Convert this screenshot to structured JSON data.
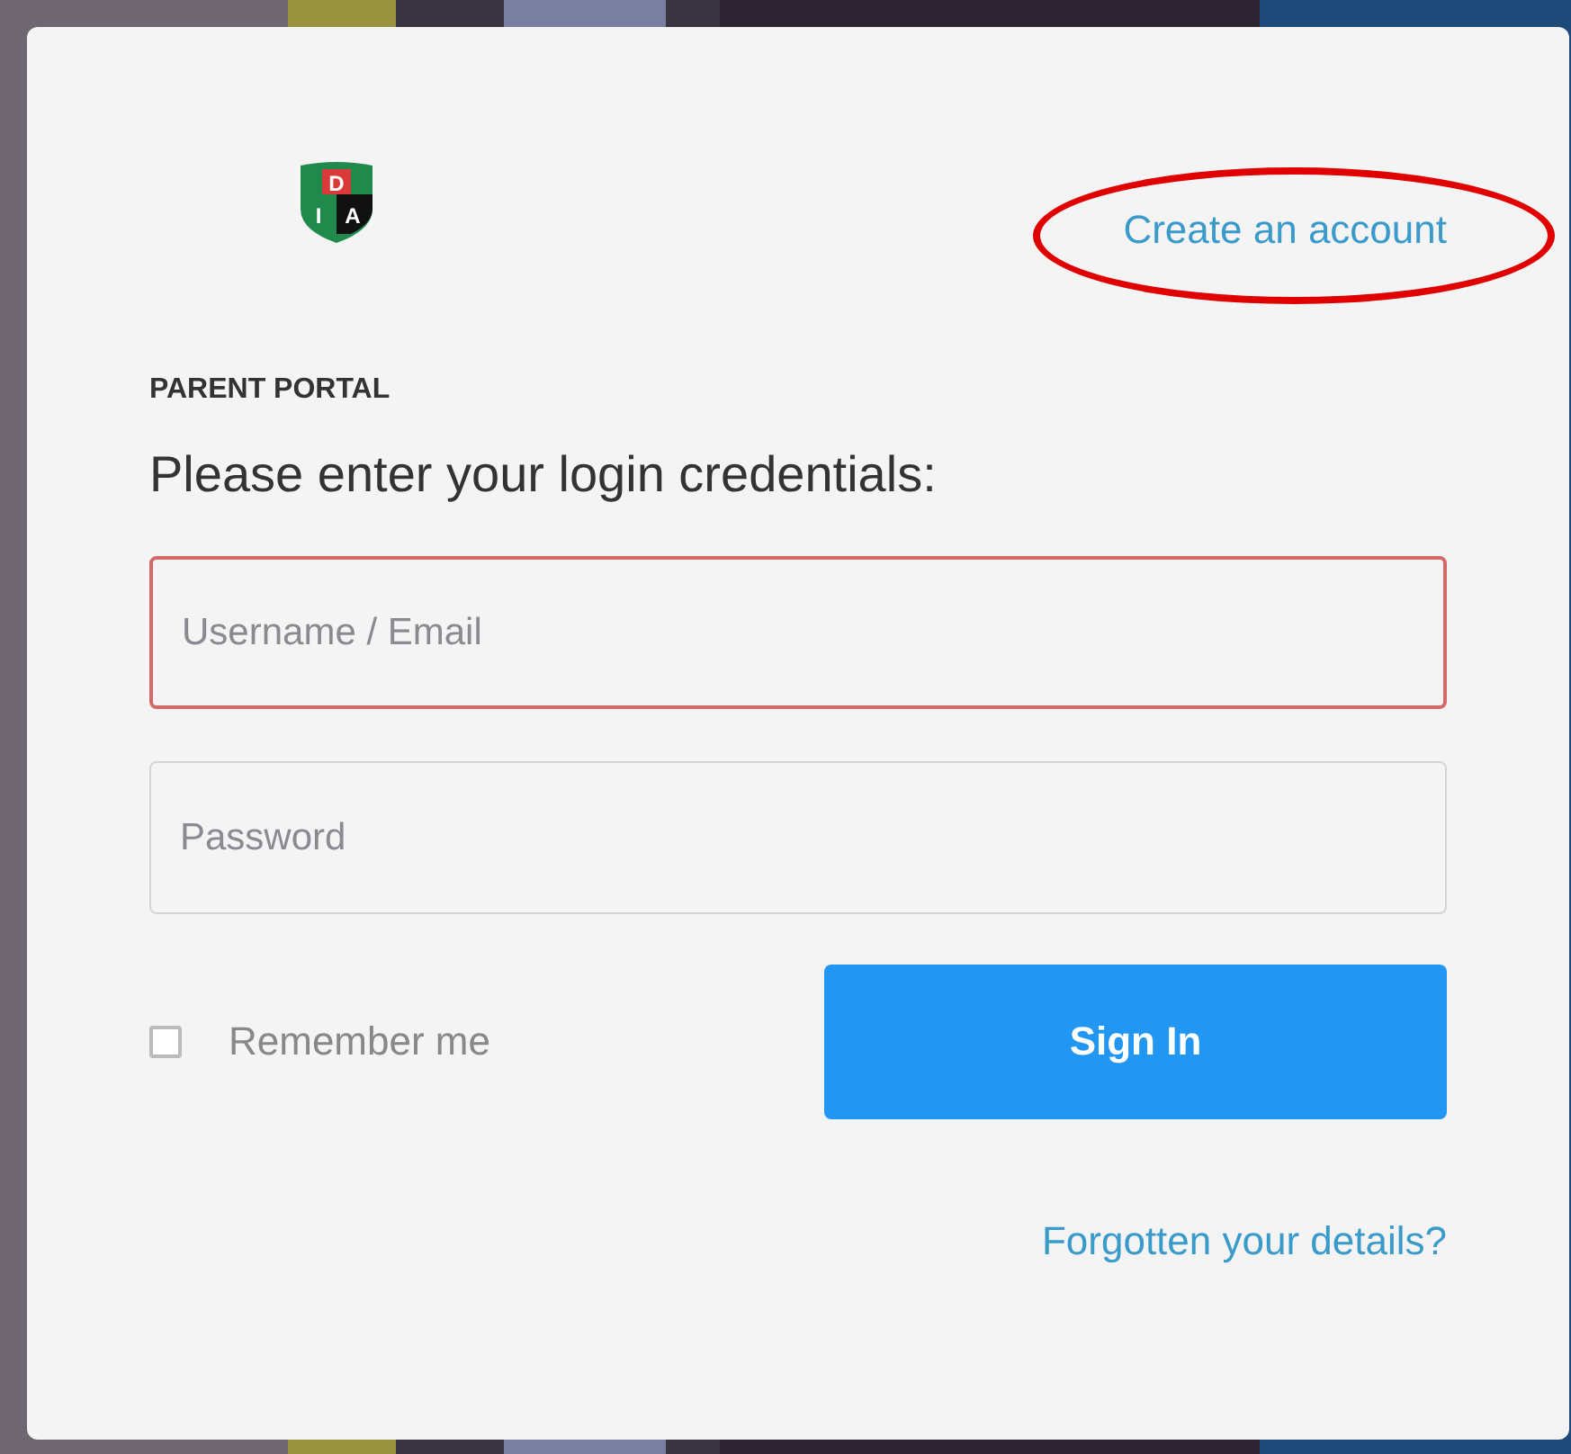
{
  "logo": {
    "letters": [
      "D",
      "I",
      "A"
    ]
  },
  "create_account_link": {
    "label": "Create an account",
    "circled": true
  },
  "portal_label": "PARENT PORTAL",
  "prompt": "Please enter your login credentials:",
  "fields": [
    {
      "placeholder": "Username / Email",
      "invalid": true
    },
    {
      "placeholder": "Password",
      "invalid": false
    }
  ],
  "remember_me": {
    "label": "Remember me",
    "checked": false
  },
  "sign_in_button": "Sign In",
  "forgot_link": "Forgotten your details?"
}
